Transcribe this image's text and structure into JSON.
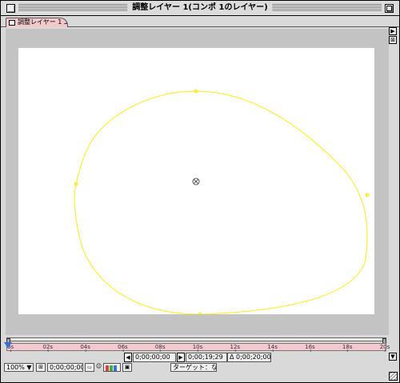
{
  "window": {
    "title": "調整レイヤー 1(コンポ 1のレイヤー)",
    "tab_label": "調整レイヤー 1 ⅃"
  },
  "ruler": {
    "ticks": [
      "0s",
      "02s",
      "04s",
      "06s",
      "08s",
      "10s",
      "12s",
      "14s",
      "16s",
      "18s",
      "20s"
    ]
  },
  "time": {
    "in_point": "0;00;00;00",
    "out_point": "0;00;19;29",
    "duration": "Δ 0;00;20;00"
  },
  "controls": {
    "zoom": "100%",
    "current_time": "0;00;00;00",
    "target": "ターゲット：なし"
  },
  "colors": {
    "mask_path": "#ffee33",
    "ruler_bg": "#f5c7cf",
    "tab_bg": "#f3c8cc"
  },
  "icons": {
    "close": "close-box-icon",
    "zoom": "zoom-box-icon",
    "anchor": "anchor-point-icon"
  }
}
